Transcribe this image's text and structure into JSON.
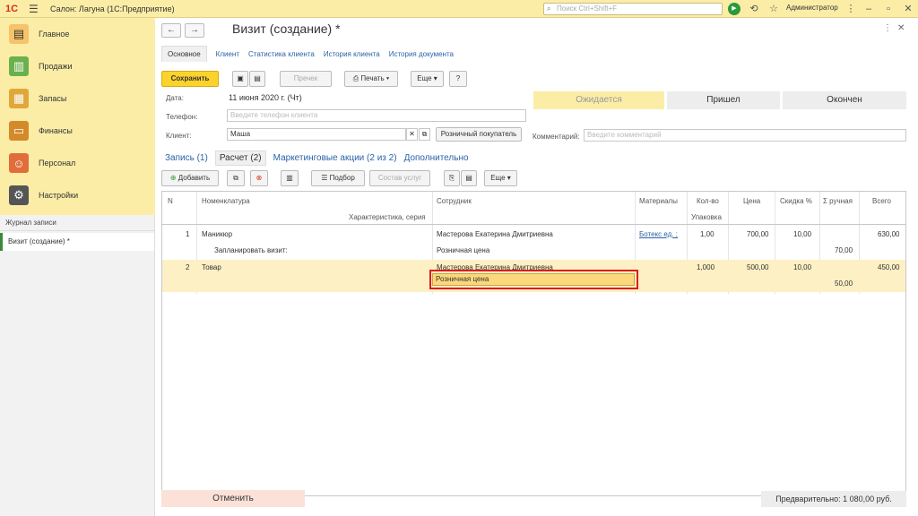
{
  "app": {
    "logo": "1С",
    "title": "Салон: Лагуна  (1С:Предприятие)",
    "search_placeholder": "Поиск Ctrl+Shift+F",
    "user": "Администратор"
  },
  "sidebar": {
    "items": [
      {
        "label": "Главное",
        "icon": "home-icon",
        "color": "#f7c36a"
      },
      {
        "label": "Продажи",
        "icon": "sales-chart-icon",
        "color": "#6ab04c"
      },
      {
        "label": "Запасы",
        "icon": "stock-icon",
        "color": "#e0a73a"
      },
      {
        "label": "Финансы",
        "icon": "wallet-icon",
        "color": "#d48a2a"
      },
      {
        "label": "Персонал",
        "icon": "people-icon",
        "color": "#e06d3a"
      },
      {
        "label": "Настройки",
        "icon": "gear-icon",
        "color": "#555555"
      }
    ],
    "journal_header": "Журнал записи",
    "journal_item": "Визит (создание) *"
  },
  "form": {
    "title": "Визит (создание) *",
    "tabs": [
      "Основное",
      "Клиент",
      "Статистика клиента",
      "История клиента",
      "История документа"
    ],
    "toolbar": {
      "save": "Сохранить",
      "receipt": "Пречек",
      "print": "Печать",
      "more": "Еще",
      "help": "?"
    },
    "date_label": "Дата:",
    "date_value": "11 июня 2020 г. (Чт)",
    "phone_label": "Телефон:",
    "phone_placeholder": "Введите телефон клиента",
    "client_label": "Клиент:",
    "client_value": "Маша",
    "retail_buyer": "Розничный покупатель",
    "comment_label": "Комментарий:",
    "comment_placeholder": "Введите комментарий",
    "statuses": [
      "Ожидается",
      "Пришел",
      "Окончен"
    ],
    "subtabs": [
      "Запись (1)",
      "Расчет (2)",
      "Маркетинговые акции (2 из 2)",
      "Дополнительно"
    ],
    "table_toolbar": {
      "add": "Добавить",
      "pick": "Подбор",
      "services": "Состав услуг",
      "more": "Еще"
    },
    "table": {
      "headers": {
        "n": "N",
        "nomenclature": "Номенклатура",
        "characteristic": "Характеристика, серия",
        "employee": "Сотрудник",
        "materials": "Материалы",
        "qty": "Кол-во",
        "package": "Упаковка",
        "price": "Цена",
        "discount": "Скидка %",
        "manual": "Σ ручная",
        "total": "Всего"
      },
      "rows": [
        {
          "n": "1",
          "name": "Маникюр",
          "sub": "Запланировать визит:",
          "employee": "Мастерова Екатерина Дмитриевна",
          "price_type": "Розничная цена",
          "materials": "Ботекс ед. ;",
          "qty": "1,00",
          "price": "700,00",
          "discount": "10,00",
          "manual": "70,00",
          "total": "630,00"
        },
        {
          "n": "2",
          "name": "Товар",
          "sub": "",
          "employee": "Мастерова Екатерина Дмитриевна",
          "price_type": "Розничная цена",
          "materials": "",
          "qty": "1,000",
          "price": "500,00",
          "discount": "10,00",
          "manual": "50,00",
          "total": "450,00"
        }
      ]
    },
    "cancel": "Отменить",
    "preliminary": "Предварительно: 1 080,00 руб."
  }
}
